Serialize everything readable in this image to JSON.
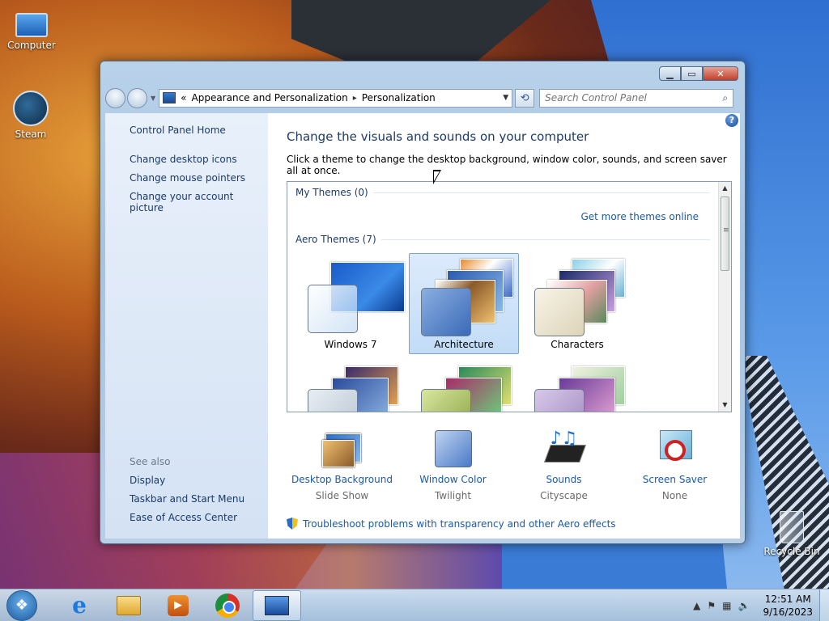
{
  "desktop": {
    "icons": [
      {
        "label": "Computer"
      },
      {
        "label": "Steam"
      },
      {
        "label": "Recycle Bin"
      }
    ]
  },
  "window": {
    "address": {
      "prefix": "«",
      "crumbs": [
        "Appearance and Personalization",
        "Personalization"
      ],
      "separator": "▸"
    },
    "search": {
      "placeholder": "Search Control Panel"
    },
    "left_pane": {
      "home": "Control Panel Home",
      "links": [
        "Change desktop icons",
        "Change mouse pointers",
        "Change your account picture"
      ],
      "see_also_label": "See also",
      "see_also": [
        "Display",
        "Taskbar and Start Menu",
        "Ease of Access Center"
      ]
    },
    "main": {
      "title": "Change the visuals and sounds on your computer",
      "description": "Click a theme to change the desktop background, window color, sounds, and screen saver all at once.",
      "my_themes": "My Themes (0)",
      "get_more": "Get more themes online",
      "aero_themes": "Aero Themes (7)",
      "themes": [
        {
          "label": "Windows 7",
          "selected": false
        },
        {
          "label": "Architecture",
          "selected": true
        },
        {
          "label": "Characters",
          "selected": false
        }
      ],
      "settings": [
        {
          "label": "Desktop Background",
          "value": "Slide Show",
          "icon": "desktop-background-icon"
        },
        {
          "label": "Window Color",
          "value": "Twilight",
          "icon": "window-color-icon"
        },
        {
          "label": "Sounds",
          "value": "Cityscape",
          "icon": "sounds-icon"
        },
        {
          "label": "Screen Saver",
          "value": "None",
          "icon": "screen-saver-icon"
        }
      ],
      "troubleshoot": "Troubleshoot problems with transparency and other Aero effects"
    }
  },
  "taskbar": {
    "clock": {
      "time": "12:51 AM",
      "date": "9/16/2023"
    }
  },
  "colors": {
    "link": "#1a5aa8",
    "title": "#1e3a6a",
    "selected_tile": "#c2dcf6"
  }
}
